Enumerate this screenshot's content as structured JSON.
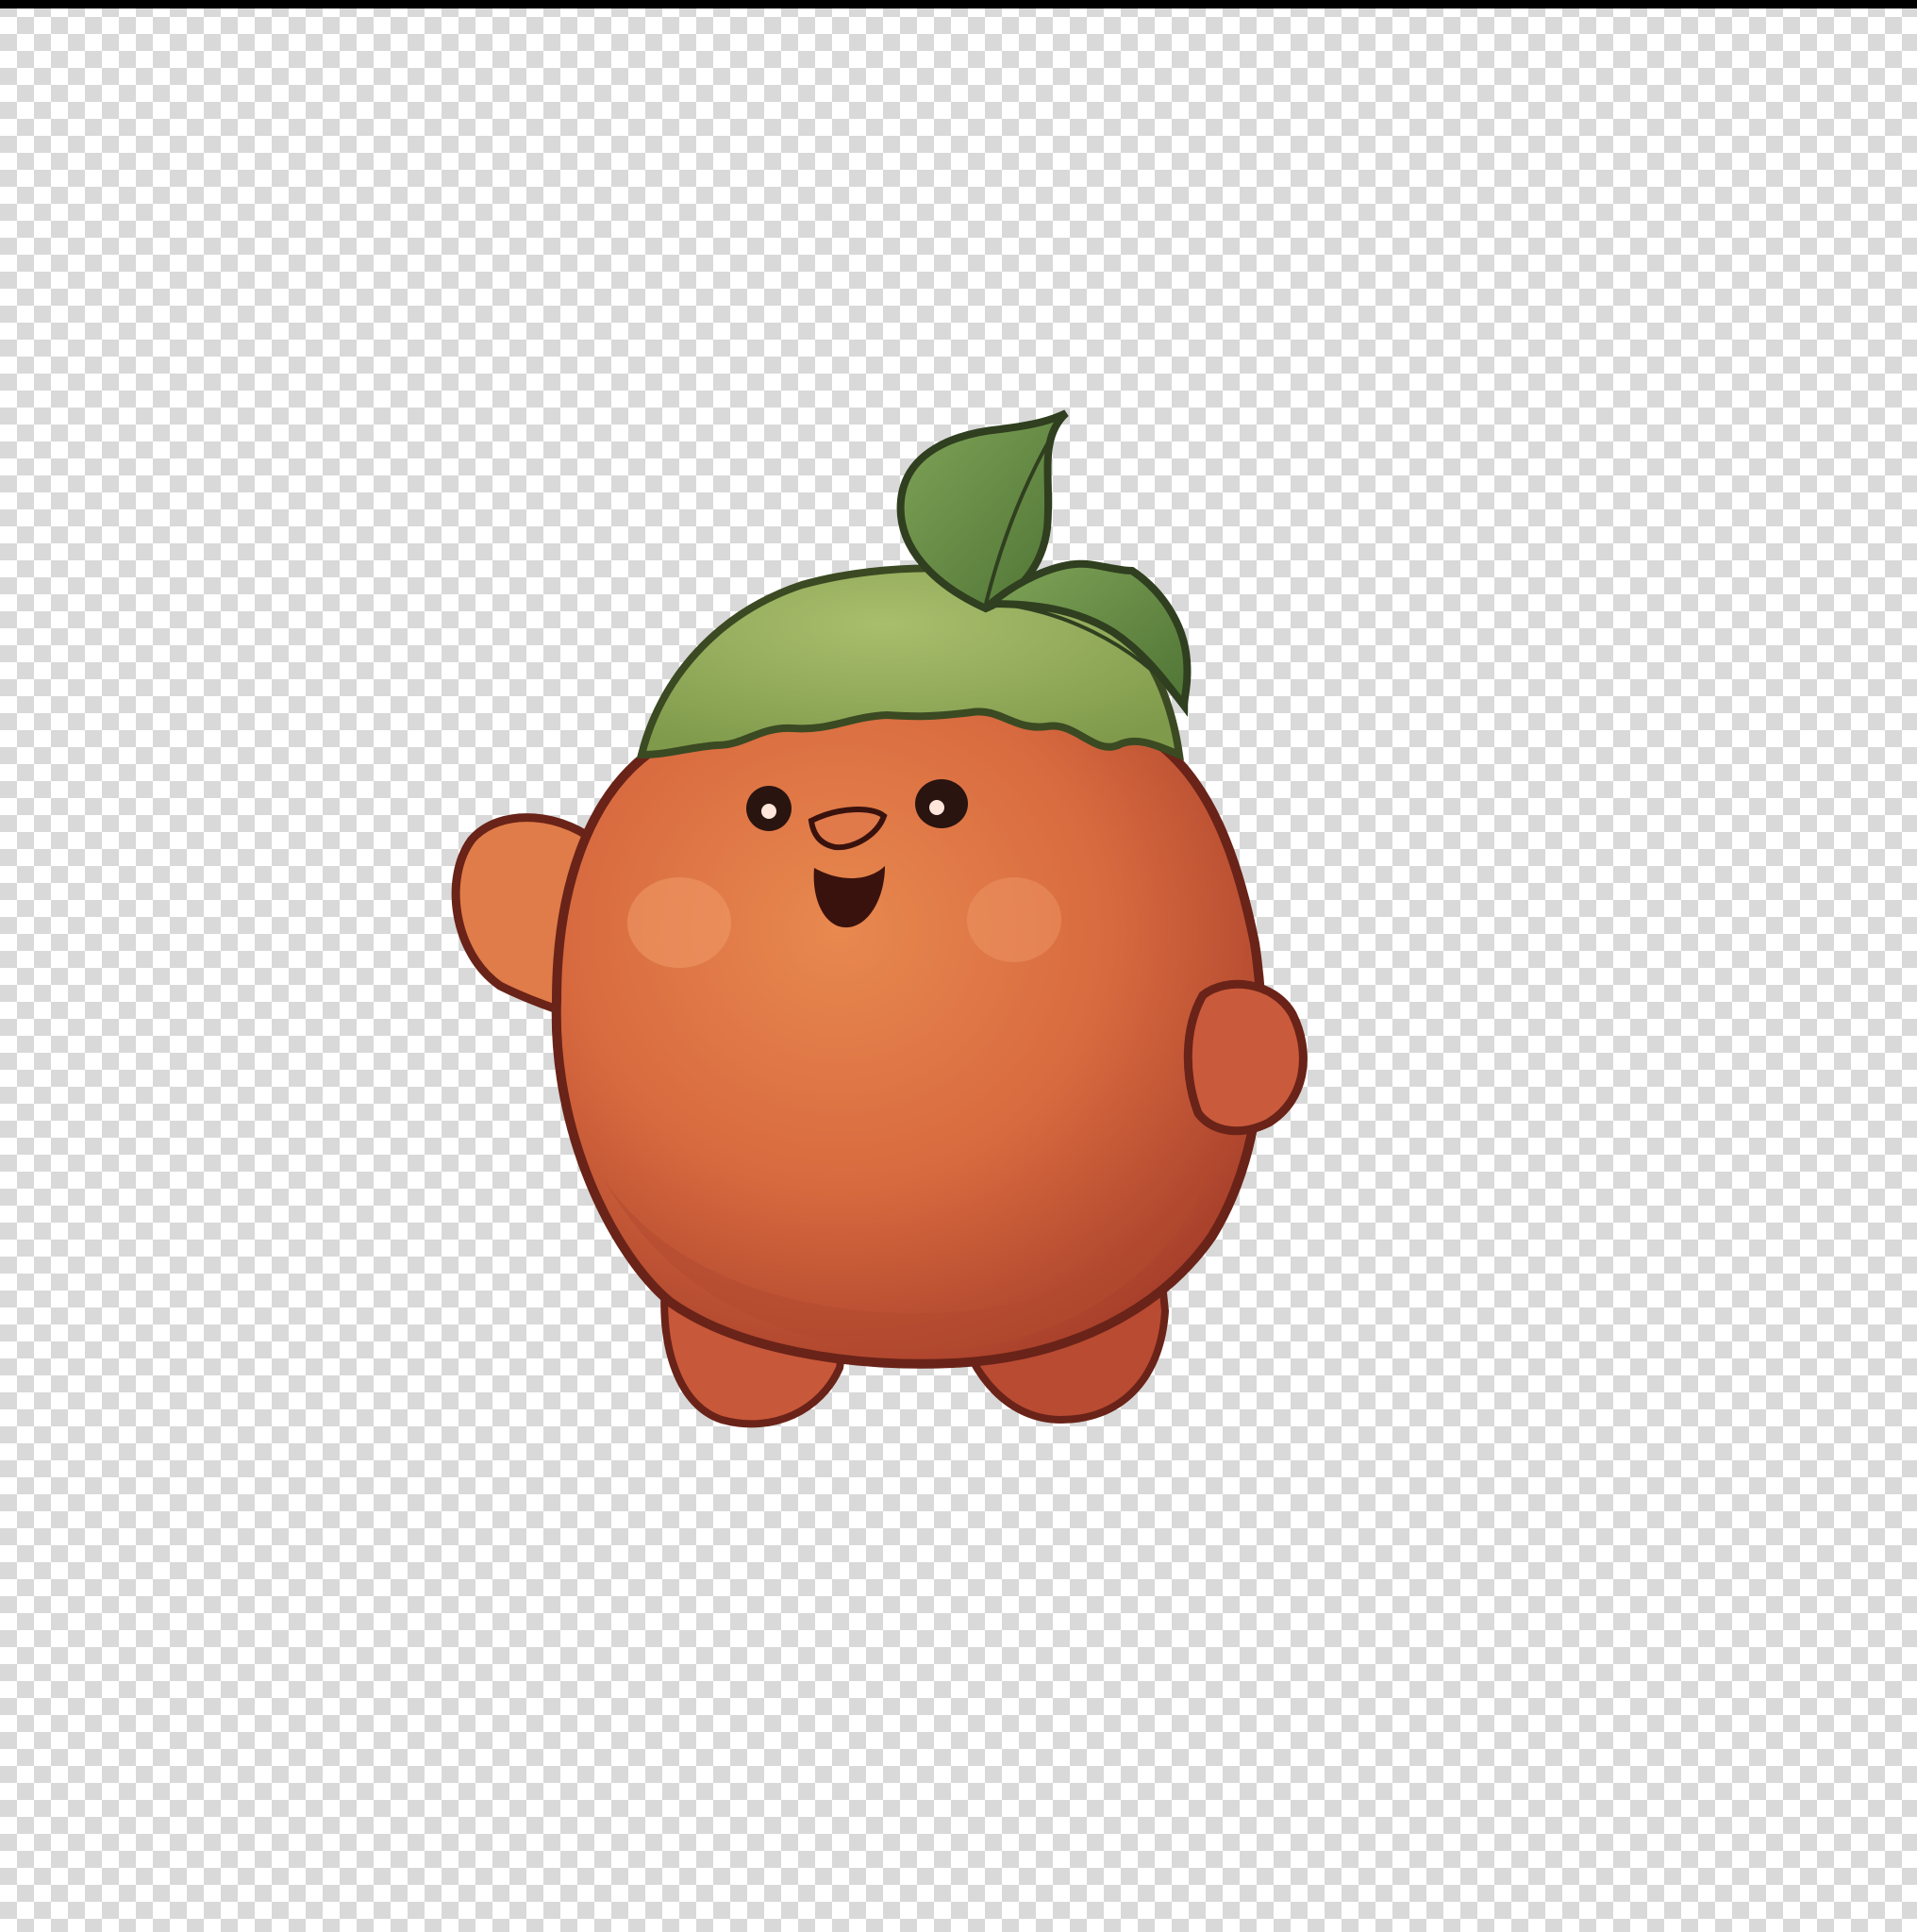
{
  "scene": {
    "subject": "orange-fruit-mascot",
    "icons": [
      "transparency-checkerboard",
      "orange-body",
      "green-cap",
      "leaf",
      "arm-left",
      "arm-right",
      "eyes",
      "beak",
      "mouth",
      "cheeks",
      "feet"
    ]
  },
  "colors": {
    "checker_light": "#ffffff",
    "checker_dark": "#d9d9d9",
    "top_bar": "#000000",
    "body_main": "#d86a3f",
    "body_light": "#e8894f",
    "body_shadow": "#a8402b",
    "outline": "#6a2318",
    "cap": "#95ae5c",
    "cap_dark": "#6f8b44",
    "leaf": "#678d44",
    "leaf_dark": "#3f5a2a",
    "eye": "#2a1410",
    "eye_shine": "#ffe5da",
    "mouth": "#3a120d",
    "cheek": "#f09a6a"
  }
}
